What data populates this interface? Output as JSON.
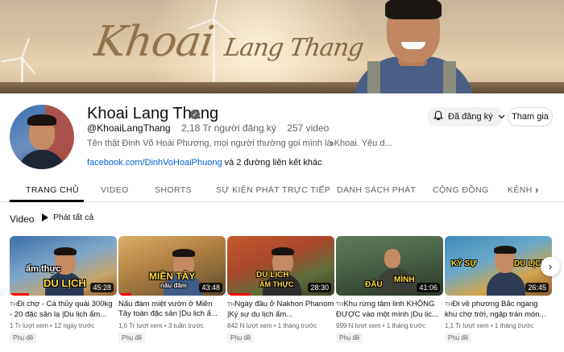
{
  "banner": {
    "title_main": "Khoai",
    "title_sub": "Lang Thang"
  },
  "channel": {
    "name": "Khoai Lang Thang",
    "handle": "@KhoaiLangThang",
    "subscribers": "2,18 Tr người đăng ký",
    "videos": "257 video",
    "description": "Tên thật Đinh Võ Hoài Phương, mọi người thường gọi mình là Khoai. Yêu d...",
    "link": "facebook.com/DinhVoHoaiPhuong",
    "link_more": "và 2 đường liên kết khác"
  },
  "actions": {
    "subscribed_label": "Đã đăng ký",
    "join_label": "Tham gia"
  },
  "tabs": [
    {
      "label": "TRANG CHỦ",
      "active": true
    },
    {
      "label": "VIDEO"
    },
    {
      "label": "SHORTS"
    },
    {
      "label": "SỰ KIỆN PHÁT TRỰC TIẾP"
    },
    {
      "label": "DANH SÁCH PHÁT"
    },
    {
      "label": "CỘNG ĐỒNG"
    },
    {
      "label": "KÊNH"
    }
  ],
  "section": {
    "title": "Video",
    "play_all": "Phát tất cả"
  },
  "videos": [
    {
      "caption_top": "ẩm thực",
      "caption_bottom": "DU LỊCH",
      "duration": "45:28",
      "progress": 0.18,
      "title": "Đi chợ - Cá thủy quái 300kg - 20 đặc sản lạ |Du lịch ẩm...",
      "views": "1 Tr lượt xem",
      "age": "12 ngày trước",
      "badge": "Phụ đề"
    },
    {
      "caption_top": "MIỀN TÂY",
      "caption_bottom": "nấu đãm",
      "duration": "43:48",
      "progress": 0.12,
      "title": "Nấu đám miệt vườn ở Miền Tây toàn đặc sản |Du lịch ẩ...",
      "views": "1,6 Tr lượt xem",
      "age": "3 tuần trước",
      "badge": "Phụ đề"
    },
    {
      "caption_top": "DU LỊCH",
      "caption_bottom": "ẨM THỰC",
      "duration": "28:30",
      "progress": 0.22,
      "title": "Ngày đầu ở Nakhon Phanom |Ký sự du lịch ẩm...",
      "views": "842 N lượt xem",
      "age": "1 tháng trước",
      "badge": "Phụ đề"
    },
    {
      "caption_top": "ĐẦU",
      "caption_bottom": "MÌNH",
      "duration": "41:06",
      "progress": 0.0,
      "title": "Khu rừng tâm linh KHÔNG ĐƯỢC vào một mình |Du lịc...",
      "views": "999 N lượt xem",
      "age": "1 tháng trước",
      "badge": "Phụ đề"
    },
    {
      "caption_top": "KÝ SỰ",
      "caption_bottom": "DU LỊCH",
      "duration": "26:45",
      "progress": 0.0,
      "title": "Đi về phương Bắc ngang khu chợ trời, ngập tràn món...",
      "views": "1,1 Tr lượt xem",
      "age": "1 tháng trước",
      "badge": "Phụ đề"
    }
  ],
  "video_title_prefix": "TH"
}
